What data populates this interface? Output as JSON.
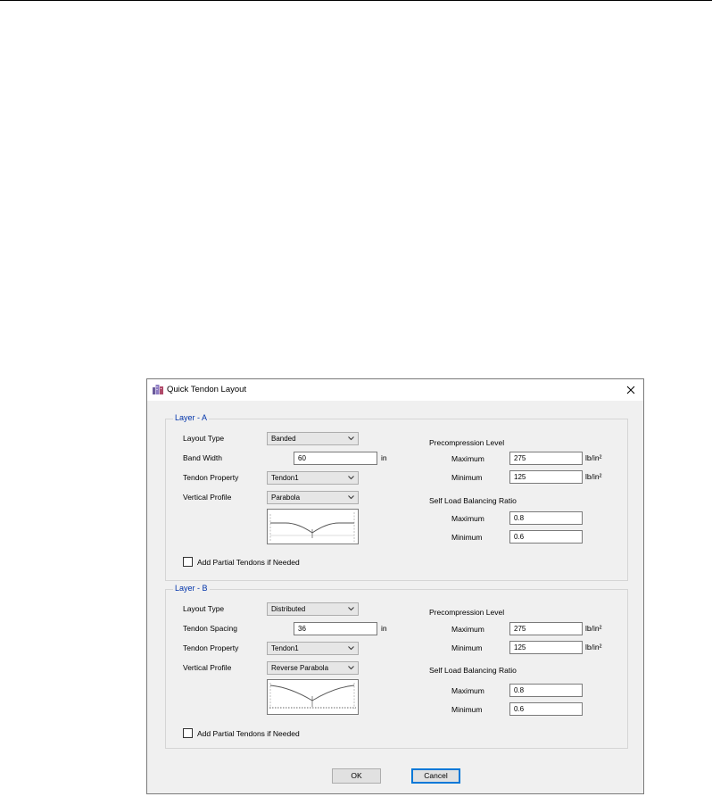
{
  "dialog": {
    "title": "Quick Tendon Layout",
    "ok_label": "OK",
    "cancel_label": "Cancel"
  },
  "layer_a": {
    "legend": "Layer - A",
    "layout_type_label": "Layout Type",
    "layout_type_value": "Banded",
    "band_width_label": "Band Width",
    "band_width_value": "60",
    "band_width_unit": "in",
    "tendon_property_label": "Tendon Property",
    "tendon_property_value": "Tendon1",
    "vertical_profile_label": "Vertical Profile",
    "vertical_profile_value": "Parabola",
    "partial_tendons_label": "Add Partial Tendons if Needed",
    "precompression_label": "Precompression Level",
    "pre_max_label": "Maximum",
    "pre_max_value": "275",
    "pre_max_unit": "lb/in²",
    "pre_min_label": "Minimum",
    "pre_min_value": "125",
    "pre_min_unit": "lb/in²",
    "self_load_label": "Self Load Balancing Ratio",
    "slb_max_label": "Maximum",
    "slb_max_value": "0.8",
    "slb_min_label": "Minimum",
    "slb_min_value": "0.6"
  },
  "layer_b": {
    "legend": "Layer - B",
    "layout_type_label": "Layout Type",
    "layout_type_value": "Distributed",
    "tendon_spacing_label": "Tendon Spacing",
    "tendon_spacing_value": "36",
    "tendon_spacing_unit": "in",
    "tendon_property_label": "Tendon Property",
    "tendon_property_value": "Tendon1",
    "vertical_profile_label": "Vertical Profile",
    "vertical_profile_value": "Reverse Parabola",
    "partial_tendons_label": "Add Partial Tendons if Needed",
    "precompression_label": "Precompression Level",
    "pre_max_label": "Maximum",
    "pre_max_value": "275",
    "pre_max_unit": "lb/in²",
    "pre_min_label": "Minimum",
    "pre_min_value": "125",
    "pre_min_unit": "lb/in²",
    "self_load_label": "Self Load Balancing Ratio",
    "slb_max_label": "Maximum",
    "slb_max_value": "0.8",
    "slb_min_label": "Minimum",
    "slb_min_value": "0.6"
  },
  "icons": {
    "app": "app-building-icon",
    "close": "close-icon",
    "dropdown": "chevron-down-icon"
  },
  "colors": {
    "legend": "#0033aa",
    "dialog_bg": "#f0f0f0",
    "default_button_border": "#0078d7"
  }
}
